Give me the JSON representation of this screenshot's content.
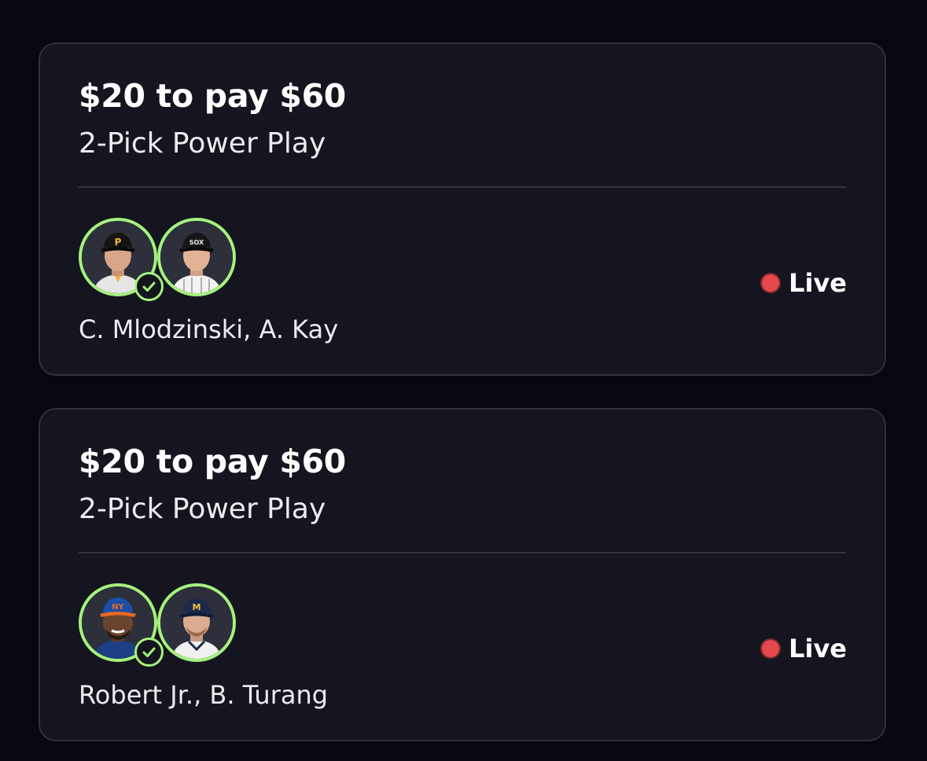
{
  "colors": {
    "page_background": "#07080f",
    "card_background": "#14151e",
    "card_border": "#2f3039",
    "avatar_ring": "#a4f27d",
    "live_dot": "#e5484d"
  },
  "entries": [
    {
      "amount": "$20 to pay $60",
      "type": "2-Pick Power Play",
      "players": "C. Mlodzinski, A. Kay",
      "status": "Live",
      "status_icon": "red-dot-icon",
      "avatars": [
        {
          "name": "player-photo",
          "cap_color": "#141414",
          "cap_logo": "P",
          "jersey_color": "#e6e6e6",
          "skin": "#d9a68a"
        },
        {
          "name": "player-photo",
          "cap_color": "#161616",
          "cap_logo": "SOX",
          "jersey_color": "#f2f2f2",
          "skin": "#e2b295"
        }
      ],
      "completed_pick_icon": "checkmark-icon"
    },
    {
      "amount": "$20 to pay $60",
      "type": "2-Pick Power Play",
      "players": "Robert Jr., B. Turang",
      "status": "Live",
      "status_icon": "red-dot-icon",
      "avatars": [
        {
          "name": "player-photo",
          "cap_color": "#1d4ea8",
          "cap_logo": "NY",
          "jersey_color": "#1d3f86",
          "skin": "#6b442f"
        },
        {
          "name": "player-photo",
          "cap_color": "#1b2a4a",
          "cap_logo": "M",
          "jersey_color": "#f0f0f0",
          "skin": "#dcae91"
        }
      ],
      "completed_pick_icon": "checkmark-icon"
    }
  ]
}
